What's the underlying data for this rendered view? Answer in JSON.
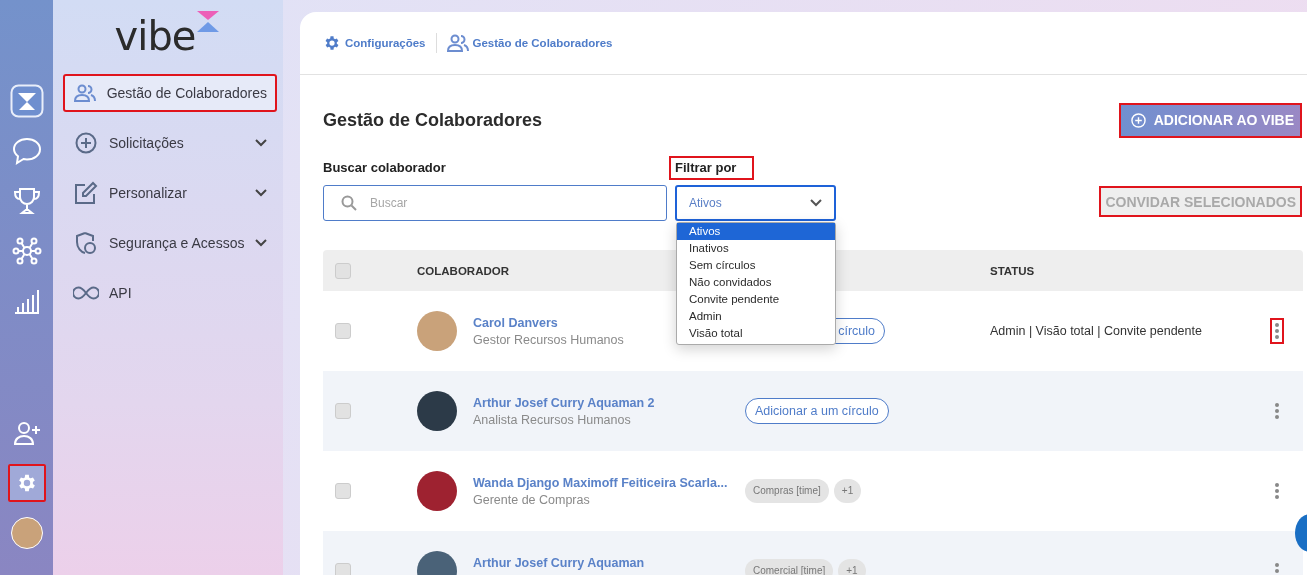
{
  "rail": {
    "items": [
      {
        "kind": "logo",
        "selected": false,
        "highlighted": false
      },
      {
        "kind": "chat",
        "selected": false,
        "highlighted": false
      },
      {
        "kind": "trophy",
        "selected": false,
        "highlighted": false
      },
      {
        "kind": "network",
        "selected": false,
        "highlighted": false
      },
      {
        "kind": "chart",
        "selected": false,
        "highlighted": false
      },
      {
        "kind": "add-user",
        "selected": false,
        "highlighted": false
      },
      {
        "kind": "settings",
        "selected": true,
        "highlighted": true
      },
      {
        "kind": "avatar",
        "selected": false,
        "highlighted": false
      }
    ]
  },
  "sidebar": {
    "logo": "vibe",
    "items": [
      {
        "label": "Gestão de Colaboradores",
        "kind": "people",
        "expandable": false,
        "selected": true,
        "highlighted": true
      },
      {
        "label": "Solicitações",
        "kind": "plus-circle",
        "expandable": true,
        "selected": false,
        "highlighted": false
      },
      {
        "label": "Personalizar",
        "kind": "edit",
        "expandable": true,
        "selected": false,
        "highlighted": false
      },
      {
        "label": "Segurança e Acessos",
        "kind": "shield",
        "expandable": true,
        "selected": false,
        "highlighted": false
      },
      {
        "label": "API",
        "kind": "infinity",
        "expandable": false,
        "selected": false,
        "highlighted": false
      }
    ]
  },
  "breadcrumb": [
    {
      "label": "Configurações",
      "kind": "gear"
    },
    {
      "label": "Gestão de Colaboradores",
      "kind": "people"
    }
  ],
  "title": "Gestão de Colaboradores",
  "add_button": {
    "label": "ADICIONAR AO VIBE",
    "highlighted": true
  },
  "search": {
    "label": "Buscar colaborador",
    "placeholder": "Buscar"
  },
  "filter": {
    "label": "Filtrar por",
    "highlighted": true,
    "value": "Ativos",
    "expanded": true,
    "options": [
      {
        "label": "Ativos",
        "selected": true
      },
      {
        "label": "Inativos",
        "selected": false
      },
      {
        "label": "Sem círculos",
        "selected": false
      },
      {
        "label": "Não convidados",
        "selected": false
      },
      {
        "label": "Convite pendente",
        "selected": false
      },
      {
        "label": "Admin",
        "selected": false
      },
      {
        "label": "Visão total",
        "selected": false
      }
    ]
  },
  "invite_button": {
    "label": "CONVIDAR SELECIONADOS",
    "disabled": true,
    "highlighted": true
  },
  "table": {
    "header_checked": false,
    "columns": {
      "colaborador": "COLABORADOR",
      "status": "STATUS"
    },
    "rows": [
      {
        "name": "Carol Danvers",
        "role": "Gestor Recursos Humanos",
        "checked": false,
        "circle": {
          "kind": "button",
          "label": "círculo"
        },
        "status": "Admin | Visão total | Convite pendente",
        "menu_highlighted": true
      },
      {
        "name": "Arthur Josef Curry Aquaman 2",
        "role": "Analista Recursos Humanos",
        "checked": false,
        "circle": {
          "kind": "button",
          "label": "Adicionar a um círculo"
        },
        "menu_highlighted": false
      },
      {
        "name": "Wanda Django Maximoff Feiticeira Scarla...",
        "role": "Gerente de Compras",
        "checked": false,
        "circle": {
          "kind": "tags",
          "tags": [
            "Compras [time]",
            "+1"
          ]
        },
        "menu_highlighted": false
      },
      {
        "name": "Arthur Josef Curry Aquaman",
        "checked": false,
        "circle": {
          "kind": "tags",
          "tags": [
            "Comercial [time]",
            "+1"
          ]
        },
        "menu_highlighted": false
      }
    ]
  }
}
